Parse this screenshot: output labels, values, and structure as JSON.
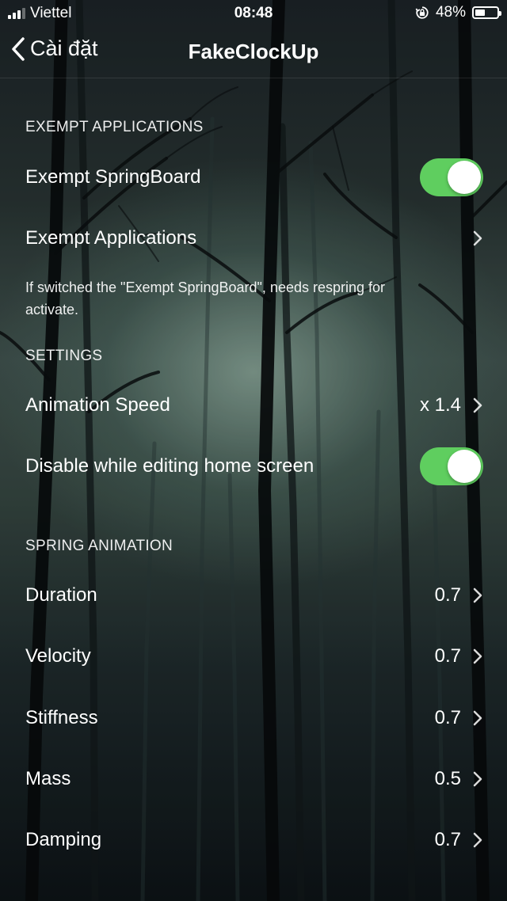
{
  "status_bar": {
    "carrier": "Viettel",
    "time": "08:48",
    "battery_percent_text": "48%",
    "battery_level": 0.48,
    "signal_bars": 3
  },
  "navbar": {
    "back_label": "Cài đặt",
    "title": "FakeClockUp"
  },
  "sections": {
    "exempt": {
      "header": "EXEMPT APPLICATIONS",
      "exempt_springboard": {
        "label": "Exempt SpringBoard",
        "on": true
      },
      "exempt_applications": {
        "label": "Exempt Applications"
      },
      "footer": "If switched the \"Exempt SpringBoard\", needs respring for activate."
    },
    "settings": {
      "header": "SETTINGS",
      "animation_speed": {
        "label": "Animation Speed",
        "value": "x 1.4"
      },
      "disable_editing": {
        "label": "Disable while editing home screen",
        "on": true
      }
    },
    "spring": {
      "header": "SPRING ANIMATION",
      "duration": {
        "label": "Duration",
        "value": "0.7"
      },
      "velocity": {
        "label": "Velocity",
        "value": "0.7"
      },
      "stiffness": {
        "label": "Stiffness",
        "value": "0.7"
      },
      "mass": {
        "label": "Mass",
        "value": "0.5"
      },
      "damping": {
        "label": "Damping",
        "value": "0.7"
      }
    }
  },
  "colors": {
    "toggle_on": "#5fce5f",
    "text": "#ffffff"
  }
}
